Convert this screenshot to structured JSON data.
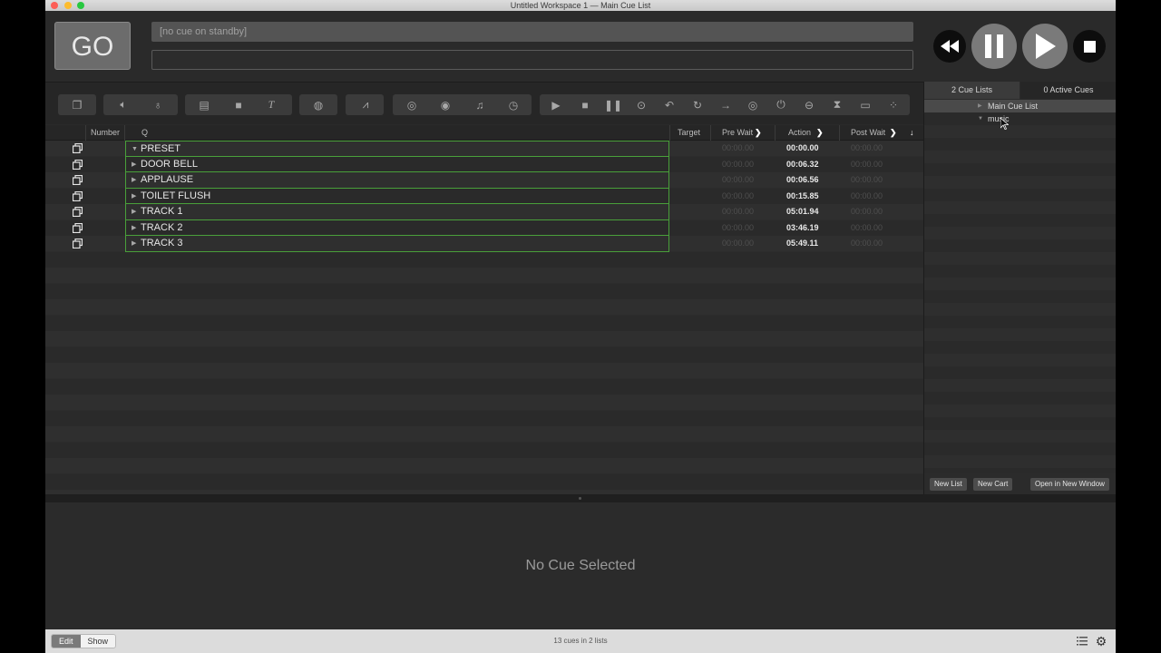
{
  "window": {
    "title": "Untitled Workspace 1 — Main Cue List"
  },
  "go": {
    "label": "GO"
  },
  "standby": {
    "text": "[no cue on standby]",
    "notes": ""
  },
  "toolbar": {
    "icons": [
      "group-cue-icon",
      "audio-cue-icon",
      "mic-cue-icon",
      "video-cue-icon",
      "camera-cue-icon",
      "text-cue-icon",
      "light-cue-icon",
      "fade-cue-icon",
      "network-cue-icon",
      "midi-cue-icon",
      "midi-file-cue-icon",
      "timecode-cue-icon",
      "start-cue-icon",
      "stop-cue-icon",
      "pause-cue-icon",
      "load-cue-icon",
      "reset-cue-icon",
      "devamp-cue-icon",
      "goto-cue-icon",
      "target-cue-icon",
      "arm-cue-icon",
      "disarm-cue-icon",
      "wait-cue-icon",
      "memo-cue-icon",
      "script-cue-icon"
    ]
  },
  "columns": {
    "number": "Number",
    "q": "Q",
    "target": "Target",
    "prewait": "Pre Wait",
    "action": "Action",
    "postwait": "Post Wait"
  },
  "cues": [
    {
      "name": "PRESET",
      "prewait": "00:00.00",
      "action": "00:00.00",
      "postwait": "00:00.00",
      "expanded": true
    },
    {
      "name": "DOOR BELL",
      "prewait": "00:00.00",
      "action": "00:06.32",
      "postwait": "00:00.00",
      "expanded": false
    },
    {
      "name": "APPLAUSE",
      "prewait": "00:00.00",
      "action": "00:06.56",
      "postwait": "00:00.00",
      "expanded": false
    },
    {
      "name": "TOILET FLUSH",
      "prewait": "00:00.00",
      "action": "00:15.85",
      "postwait": "00:00.00",
      "expanded": false
    },
    {
      "name": "TRACK 1",
      "prewait": "00:00.00",
      "action": "05:01.94",
      "postwait": "00:00.00",
      "expanded": false
    },
    {
      "name": "TRACK 2",
      "prewait": "00:00.00",
      "action": "03:46.19",
      "postwait": "00:00.00",
      "expanded": false
    },
    {
      "name": "TRACK 3",
      "prewait": "00:00.00",
      "action": "05:49.11",
      "postwait": "00:00.00",
      "expanded": false
    }
  ],
  "sidebar": {
    "tabs": [
      "2 Cue Lists",
      "0 Active Cues"
    ],
    "lists": [
      {
        "label": "Main Cue List",
        "selected": true
      },
      {
        "label": "music",
        "selected": false
      }
    ],
    "buttons": [
      "New List",
      "New Cart",
      "Open in New Window"
    ]
  },
  "inspector": {
    "empty_text": "No Cue Selected"
  },
  "statusbar": {
    "modes": [
      "Edit",
      "Show"
    ],
    "active_mode": "Edit",
    "count": "13 cues in 2 lists"
  },
  "colors": {
    "selection_border": "#49a03a",
    "background": "#2a2a2a"
  }
}
